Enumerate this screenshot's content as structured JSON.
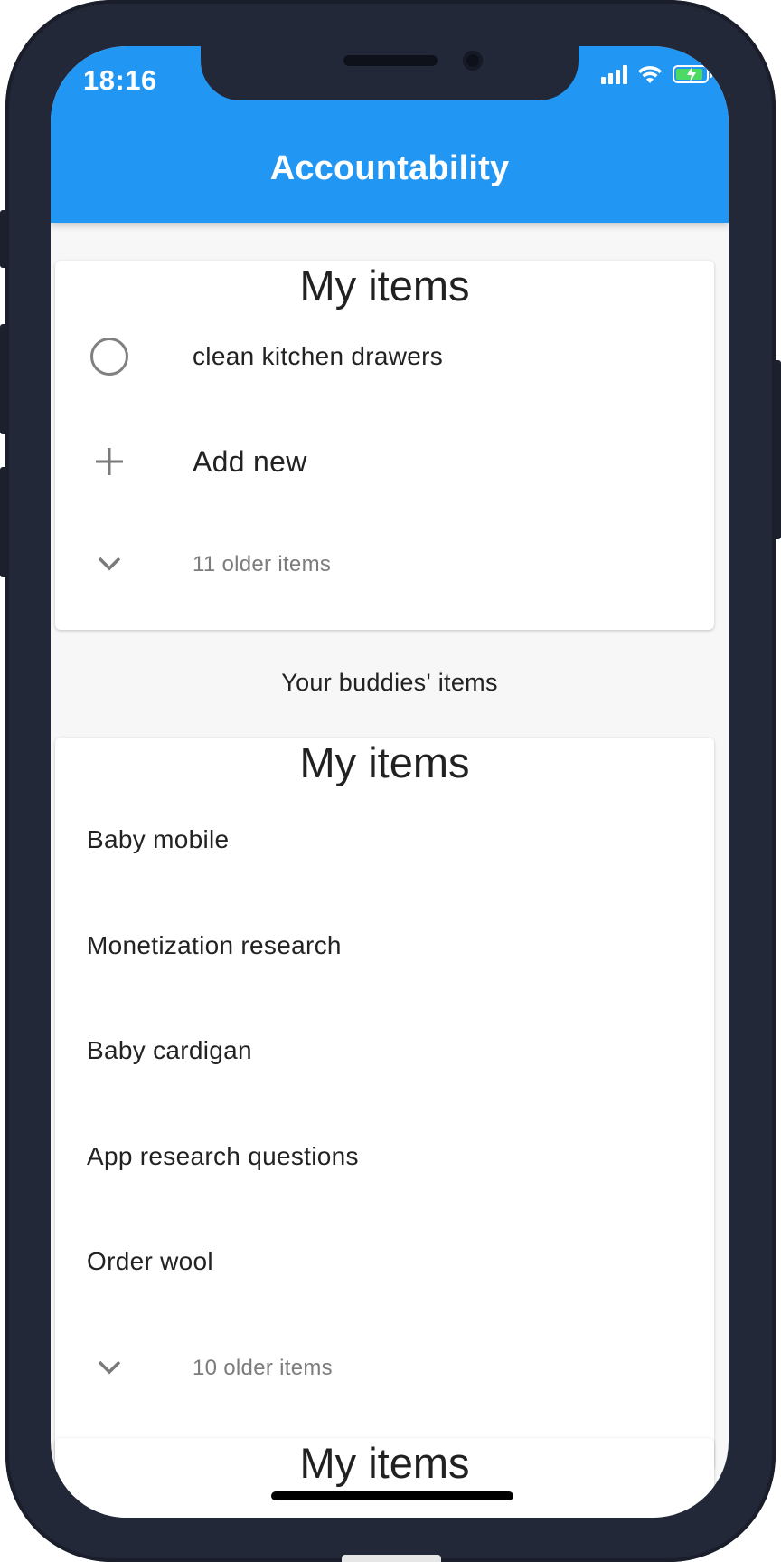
{
  "status_bar": {
    "time": "18:16"
  },
  "app_bar": {
    "title": "Accountability"
  },
  "my_card": {
    "title": "My items",
    "items": [
      {
        "label": "clean kitchen drawers"
      }
    ],
    "add_new_label": "Add new",
    "older_label": "11 older items"
  },
  "buddies_heading": "Your buddies' items",
  "buddy_card": {
    "title": "My items",
    "items": [
      {
        "label": "Baby mobile"
      },
      {
        "label": "Monetization research"
      },
      {
        "label": "Baby cardigan"
      },
      {
        "label": "App research questions"
      },
      {
        "label": "Order wool"
      }
    ],
    "older_label": "10 older items"
  },
  "third_card": {
    "title": "My items"
  },
  "colors": {
    "app_bar": "#2196f3",
    "background": "#f7f7f7",
    "card": "#ffffff",
    "battery_fill": "#4cd964"
  },
  "icons": [
    "signal-icon",
    "wifi-icon",
    "battery-icon",
    "radio-unchecked-icon",
    "plus-icon",
    "chevron-down-icon"
  ]
}
